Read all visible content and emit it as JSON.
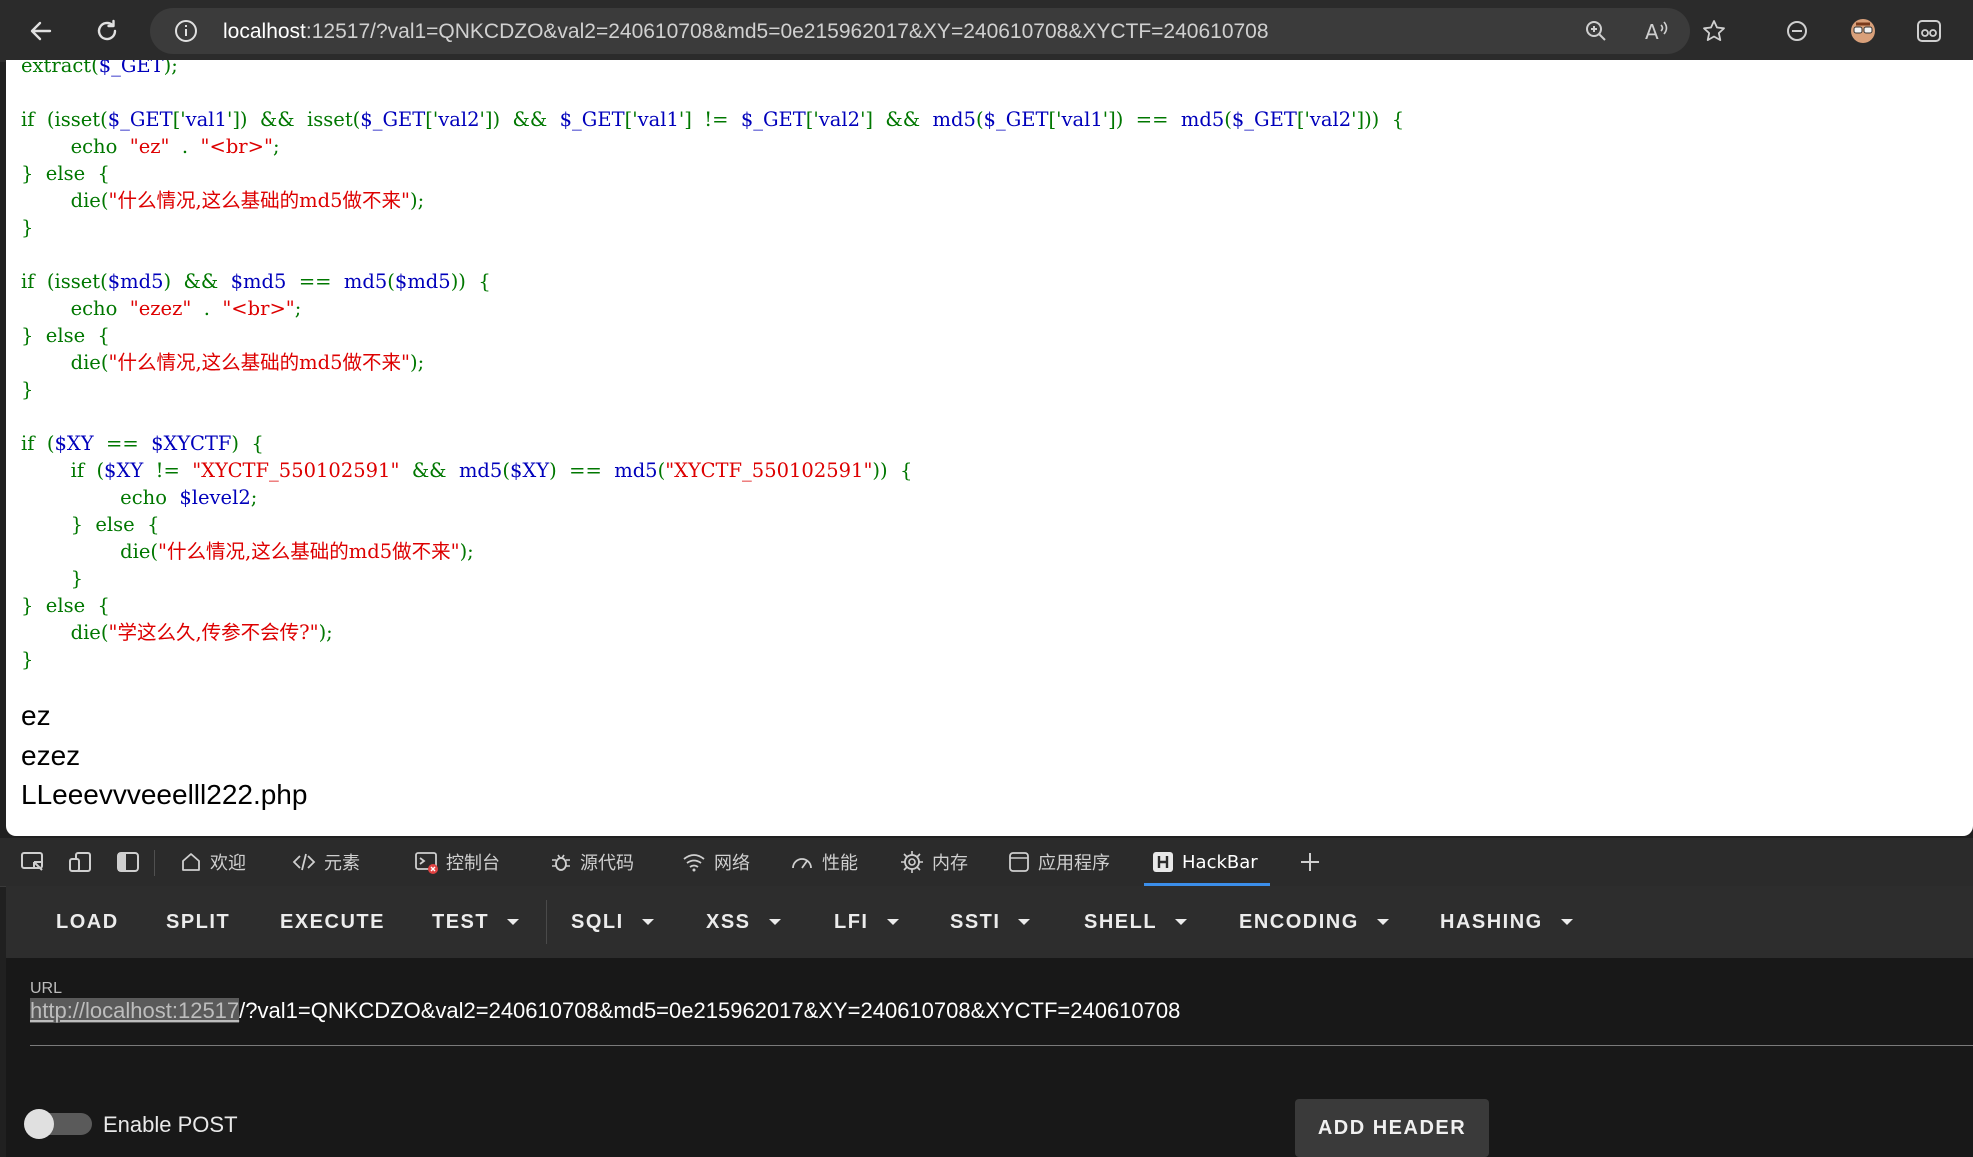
{
  "browser": {
    "address": {
      "host": "localhost",
      "rest": ":12517/?val1=QNKCDZO&val2=240610708&md5=0e215962017&XY=240610708&XYCTF=240610708"
    }
  },
  "code_lines": [
    [
      [
        "kw",
        "extract("
      ],
      [
        "var",
        "$_GET"
      ],
      [
        "kw",
        ");"
      ]
    ],
    [],
    [
      [
        "kw",
        "if  (isset("
      ],
      [
        "var",
        "$_GET"
      ],
      [
        "kw",
        "['"
      ],
      [
        "var",
        "val1"
      ],
      [
        "kw",
        "'])  &&  isset("
      ],
      [
        "var",
        "$_GET"
      ],
      [
        "kw",
        "['"
      ],
      [
        "var",
        "val2"
      ],
      [
        "kw",
        "'])  &&  "
      ],
      [
        "var",
        "$_GET"
      ],
      [
        "kw",
        "['"
      ],
      [
        "var",
        "val1"
      ],
      [
        "kw",
        "']  !=  "
      ],
      [
        "var",
        "$_GET"
      ],
      [
        "kw",
        "['"
      ],
      [
        "var",
        "val2"
      ],
      [
        "kw",
        "']  &&  "
      ],
      [
        "var",
        "md5"
      ],
      [
        "kw",
        "("
      ],
      [
        "var",
        "$_GET"
      ],
      [
        "kw",
        "['"
      ],
      [
        "var",
        "val1"
      ],
      [
        "kw",
        "'])  ==  "
      ],
      [
        "var",
        "md5"
      ],
      [
        "kw",
        "("
      ],
      [
        "var",
        "$_GET"
      ],
      [
        "kw",
        "['"
      ],
      [
        "var",
        "val2"
      ],
      [
        "kw",
        "']))  {"
      ]
    ],
    [
      [
        "kw",
        "        echo  "
      ],
      [
        "str",
        "\"ez\""
      ],
      [
        "kw",
        "  .  "
      ],
      [
        "str",
        "\"<br>\""
      ],
      [
        "kw",
        ";"
      ]
    ],
    [
      [
        "kw",
        "}  else  {"
      ]
    ],
    [
      [
        "kw",
        "        die("
      ],
      [
        "str",
        "\"什么情况,这么基础的md5做不来\""
      ],
      [
        "kw",
        ");"
      ]
    ],
    [
      [
        "kw",
        "}"
      ]
    ],
    [],
    [
      [
        "kw",
        "if  (isset("
      ],
      [
        "var",
        "$md5"
      ],
      [
        "kw",
        ")  &&  "
      ],
      [
        "var",
        "$md5"
      ],
      [
        "kw",
        "  ==  "
      ],
      [
        "var",
        "md5"
      ],
      [
        "kw",
        "("
      ],
      [
        "var",
        "$md5"
      ],
      [
        "kw",
        "))  {"
      ]
    ],
    [
      [
        "kw",
        "        echo  "
      ],
      [
        "str",
        "\"ezez\""
      ],
      [
        "kw",
        "  .  "
      ],
      [
        "str",
        "\"<br>\""
      ],
      [
        "kw",
        ";"
      ]
    ],
    [
      [
        "kw",
        "}  else  {"
      ]
    ],
    [
      [
        "kw",
        "        die("
      ],
      [
        "str",
        "\"什么情况,这么基础的md5做不来\""
      ],
      [
        "kw",
        ");"
      ]
    ],
    [
      [
        "kw",
        "}"
      ]
    ],
    [],
    [
      [
        "kw",
        "if  ("
      ],
      [
        "var",
        "$XY"
      ],
      [
        "kw",
        "  ==  "
      ],
      [
        "var",
        "$XYCTF"
      ],
      [
        "kw",
        ")  {"
      ]
    ],
    [
      [
        "kw",
        "        if  ("
      ],
      [
        "var",
        "$XY"
      ],
      [
        "kw",
        "  !=  "
      ],
      [
        "str",
        "\"XYCTF_550102591\""
      ],
      [
        "kw",
        "  &&  "
      ],
      [
        "var",
        "md5"
      ],
      [
        "kw",
        "("
      ],
      [
        "var",
        "$XY"
      ],
      [
        "kw",
        ")  ==  "
      ],
      [
        "var",
        "md5"
      ],
      [
        "kw",
        "("
      ],
      [
        "str",
        "\"XYCTF_550102591\""
      ],
      [
        "kw",
        "))  {"
      ]
    ],
    [
      [
        "kw",
        "                echo  "
      ],
      [
        "var",
        "$level2"
      ],
      [
        "kw",
        ";"
      ]
    ],
    [
      [
        "kw",
        "        }  else  {"
      ]
    ],
    [
      [
        "kw",
        "                die("
      ],
      [
        "str",
        "\"什么情况,这么基础的md5做不来\""
      ],
      [
        "kw",
        ");"
      ]
    ],
    [
      [
        "kw",
        "        }"
      ]
    ],
    [
      [
        "kw",
        "}  else  {"
      ]
    ],
    [
      [
        "kw",
        "        die("
      ],
      [
        "str",
        "\"学这么久,传参不会传?\""
      ],
      [
        "kw",
        ");"
      ]
    ],
    [
      [
        "kw",
        "}"
      ]
    ]
  ],
  "output": [
    "ez",
    "ezez",
    "LLeeevvveeelll222.php"
  ],
  "devtools_tabs": [
    {
      "label": "欢迎",
      "icon": "home-icon"
    },
    {
      "label": "元素",
      "icon": "code-icon"
    },
    {
      "label": "控制台",
      "icon": "console-icon"
    },
    {
      "label": "源代码",
      "icon": "bug-icon"
    },
    {
      "label": "网络",
      "icon": "wifi-icon"
    },
    {
      "label": "性能",
      "icon": "gauge-icon"
    },
    {
      "label": "内存",
      "icon": "chip-icon"
    },
    {
      "label": "应用程序",
      "icon": "app-window-icon"
    },
    {
      "label": "HackBar",
      "icon": "hackbar-icon",
      "active": true
    }
  ],
  "hackbar": {
    "buttons": [
      {
        "label": "LOAD",
        "dropdown": false
      },
      {
        "label": "SPLIT",
        "dropdown": false
      },
      {
        "label": "EXECUTE",
        "dropdown": false
      },
      {
        "label": "TEST",
        "dropdown": true
      },
      {
        "label": "SQLI",
        "dropdown": true
      },
      {
        "label": "XSS",
        "dropdown": true
      },
      {
        "label": "LFI",
        "dropdown": true
      },
      {
        "label": "SSTI",
        "dropdown": true
      },
      {
        "label": "SHELL",
        "dropdown": true
      },
      {
        "label": "ENCODING",
        "dropdown": true
      },
      {
        "label": "HASHING",
        "dropdown": true
      }
    ],
    "url_label": "URL",
    "url_selected": "http://localhost:12517",
    "url_rest": "/?val1=QNKCDZO&val2=240610708&md5=0e215962017&XY=240610708&XYCTF=240610708",
    "enable_post_label": "Enable POST",
    "enable_post": false,
    "add_header_label": "ADD HEADER"
  }
}
